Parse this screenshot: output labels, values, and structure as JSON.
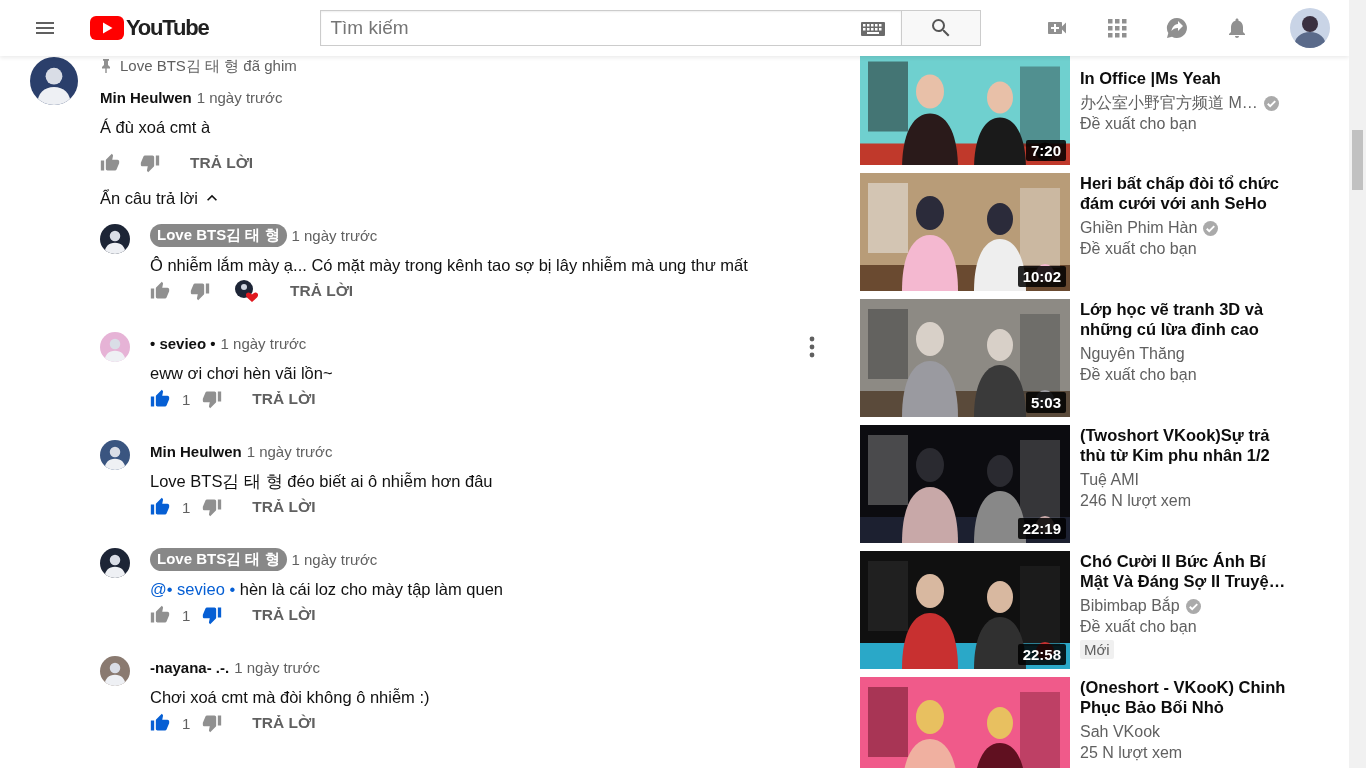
{
  "header": {
    "logo": "YouTube",
    "search": {
      "placeholder": "Tìm kiếm"
    }
  },
  "comment": {
    "pinned": "Love BTS김 태 형 đã ghim",
    "author": "Min Heulwen",
    "owner": false,
    "time": "1 ngày trước",
    "text": "Á đù xoá cmt à",
    "liked": false,
    "disliked": false,
    "reply": "TRẢ LỜI"
  },
  "replies_toggle": {
    "label": "Ẩn câu trả lời",
    "expanded": true
  },
  "replies": [
    {
      "author": "Love BTS김 태 형",
      "owner": true,
      "time": "1 ngày trước",
      "text": "Ô nhiễm lắm mày ạ... Có mặt mày trong kênh tao sợ bị lây nhiễm mà ung thư mất",
      "liked": false,
      "disliked": false,
      "hearted": true,
      "reply": "TRẢ LỜI"
    },
    {
      "author": "• sevieo •",
      "owner": false,
      "time": "1 ngày trước",
      "text": "eww ơi chơi hèn vãi lồn~",
      "liked": true,
      "likes": "1",
      "disliked": false,
      "menu": true,
      "reply": "TRẢ LỜI"
    },
    {
      "author": "Min Heulwen",
      "owner": false,
      "time": "1 ngày trước",
      "text": "Love BTS김 태 형 đéo biết ai ô nhiễm hơn đâu",
      "liked": true,
      "likes": "1",
      "disliked": false,
      "reply": "TRẢ LỜI"
    },
    {
      "author": "Love BTS김 태 형",
      "owner": true,
      "time": "1 ngày trước",
      "mention": "@• sevieo •",
      "text": "hèn là cái loz cho mày tập làm quen",
      "liked": false,
      "likes": "1",
      "disliked": true,
      "reply": "TRẢ LỜI"
    },
    {
      "author": "-nayana- .-.",
      "owner": false,
      "time": "1 ngày trước",
      "text": "Chơi xoá cmt mà đòi không ô nhiễm :)",
      "liked": true,
      "likes": "1",
      "disliked": false,
      "reply": "TRẢ LỜI"
    }
  ],
  "sidebar": [
    {
      "title": "In Office |Ms Yeah",
      "channel": "办公室小野官方频道 M…",
      "verified": true,
      "meta": "Đề xuất cho bạn",
      "duration": "7:20"
    },
    {
      "title": "Heri bất chấp đòi tổ chức đám cưới với anh SeHo",
      "channel": "Ghiền Phim Hàn",
      "verified": true,
      "meta": "Đề xuất cho bạn",
      "duration": "10:02"
    },
    {
      "title": "Lớp học vẽ tranh 3D và những cú lừa đỉnh cao",
      "channel": "Nguyên Thăng",
      "verified": false,
      "meta": "Đề xuất cho bạn",
      "duration": "5:03"
    },
    {
      "title": "(Twoshort VKook)Sự trả thù từ Kim phu nhân 1/2",
      "channel": "Tuệ AMI",
      "verified": false,
      "meta": "246 N lượt xem",
      "duration": "22:19"
    },
    {
      "title": "Chó Cười II Bức Ánh Bí Mật Và Đáng Sợ II Truyệ…",
      "channel": "Bibimbap Bắp",
      "verified": true,
      "meta": "Đề xuất cho bạn",
      "badge": "Mới",
      "duration": "22:58"
    },
    {
      "title": "(Oneshort - VKooK) Chinh Phục Bảo Bối Nhỏ",
      "channel": "Sah VKook",
      "verified": false,
      "meta": "25 N lượt xem"
    }
  ]
}
